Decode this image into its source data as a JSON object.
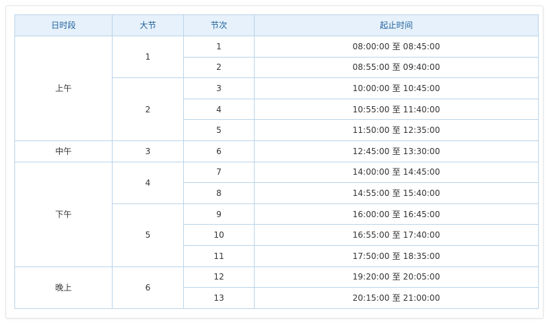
{
  "headers": [
    "日时段",
    "大节",
    "节次",
    "起止时间"
  ],
  "periods": [
    {
      "label": "上午",
      "blocks": [
        {
          "label": "1",
          "rows": [
            {
              "n": "1",
              "time": "08:00:00 至 08:45:00"
            },
            {
              "n": "2",
              "time": "08:55:00 至 09:40:00"
            }
          ]
        },
        {
          "label": "2",
          "rows": [
            {
              "n": "3",
              "time": "10:00:00 至 10:45:00"
            },
            {
              "n": "4",
              "time": "10:55:00 至 11:40:00"
            },
            {
              "n": "5",
              "time": "11:50:00 至 12:35:00"
            }
          ]
        }
      ]
    },
    {
      "label": "中午",
      "blocks": [
        {
          "label": "3",
          "rows": [
            {
              "n": "6",
              "time": "12:45:00 至 13:30:00"
            }
          ]
        }
      ]
    },
    {
      "label": "下午",
      "blocks": [
        {
          "label": "4",
          "rows": [
            {
              "n": "7",
              "time": "14:00:00 至 14:45:00"
            },
            {
              "n": "8",
              "time": "14:55:00 至 15:40:00"
            }
          ]
        },
        {
          "label": "5",
          "rows": [
            {
              "n": "9",
              "time": "16:00:00 至 16:45:00"
            },
            {
              "n": "10",
              "time": "16:55:00 至 17:40:00"
            },
            {
              "n": "11",
              "time": "17:50:00 至 18:35:00"
            }
          ]
        }
      ]
    },
    {
      "label": "晚上",
      "blocks": [
        {
          "label": "6",
          "rows": [
            {
              "n": "12",
              "time": "19:20:00 至 20:05:00"
            },
            {
              "n": "13",
              "time": "20:15:00 至 21:00:00"
            }
          ]
        }
      ]
    }
  ]
}
